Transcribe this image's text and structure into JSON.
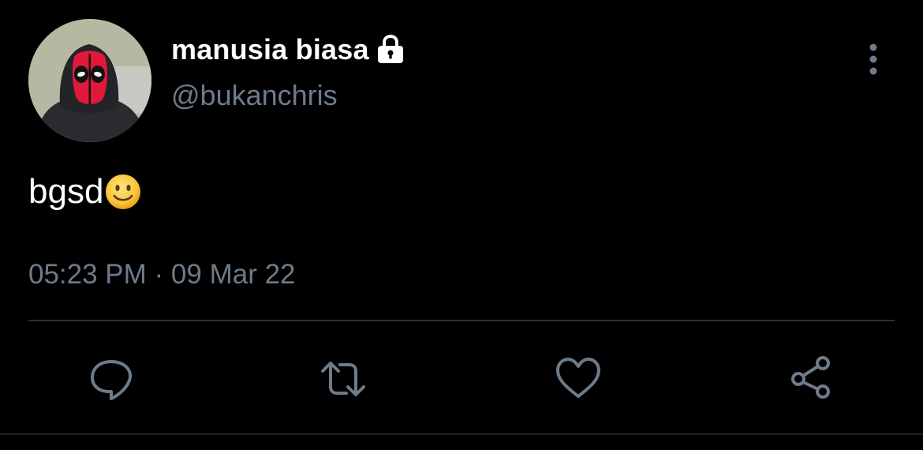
{
  "tweet": {
    "display_name": "manusia biasa",
    "handle": "@bukanchris",
    "text": "bgsd",
    "emoji": "slightly-smiling-face",
    "timestamp": "05:23 PM · 09 Mar 22",
    "protected": true
  },
  "icons": {
    "lock": "lock-icon",
    "more": "more-vertical-icon",
    "reply": "reply-icon",
    "retweet": "retweet-icon",
    "like": "heart-icon",
    "share": "share-icon"
  },
  "colors": {
    "background": "#000000",
    "primary_text": "#ffffff",
    "secondary_text": "#6e7b89",
    "divider": "#2a2f34",
    "avatar_mask": "#e0193a"
  }
}
